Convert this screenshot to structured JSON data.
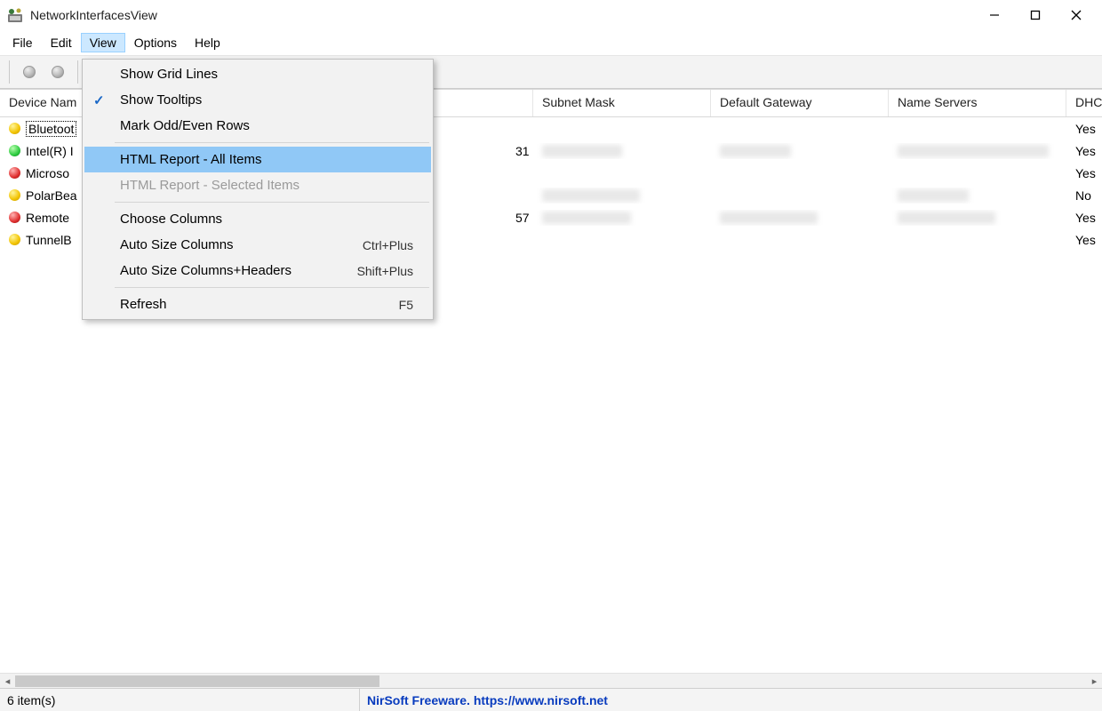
{
  "titlebar": {
    "title": "NetworkInterfacesView"
  },
  "menubar": {
    "items": [
      "File",
      "Edit",
      "View",
      "Options",
      "Help"
    ],
    "open_index": 2
  },
  "view_menu": {
    "items": [
      {
        "label": "Show Grid Lines",
        "checked": false,
        "enabled": true
      },
      {
        "label": "Show Tooltips",
        "checked": true,
        "enabled": true
      },
      {
        "label": "Mark Odd/Even Rows",
        "checked": false,
        "enabled": true
      },
      {
        "type": "sep"
      },
      {
        "label": "HTML Report - All Items",
        "enabled": true,
        "highlight": true
      },
      {
        "label": "HTML Report - Selected Items",
        "enabled": false
      },
      {
        "type": "sep"
      },
      {
        "label": "Choose Columns",
        "enabled": true
      },
      {
        "label": "Auto Size Columns",
        "enabled": true,
        "shortcut": "Ctrl+Plus"
      },
      {
        "label": "Auto Size Columns+Headers",
        "enabled": true,
        "shortcut": "Shift+Plus"
      },
      {
        "type": "sep"
      },
      {
        "label": "Refresh",
        "enabled": true,
        "shortcut": "F5"
      }
    ]
  },
  "columns": {
    "name": "Device Nam",
    "ip_hidden_header": "",
    "subnet": "Subnet Mask",
    "gateway": "Default Gateway",
    "nameservers": "Name Servers",
    "dhcp": "DHCP"
  },
  "rows": [
    {
      "status_color": "yellow",
      "name": "Bluetoot",
      "ip_tail": "",
      "subnet_blur_w": 0,
      "gw_blur_w": 0,
      "ns_blur_w": 0,
      "dhcp": "Yes",
      "focused": true
    },
    {
      "status_color": "green",
      "name": "Intel(R) I",
      "ip_tail": "31",
      "subnet_blur_w": 90,
      "gw_blur_w": 80,
      "ns_blur_w": 170,
      "dhcp": "Yes"
    },
    {
      "status_color": "red",
      "name": "Microso",
      "ip_tail": "",
      "subnet_blur_w": 0,
      "gw_blur_w": 0,
      "ns_blur_w": 0,
      "dhcp": "Yes"
    },
    {
      "status_color": "yellow",
      "name": "PolarBea",
      "ip_tail": "",
      "subnet_blur_w": 110,
      "gw_blur_w": 0,
      "ns_blur_w": 80,
      "dhcp": "No"
    },
    {
      "status_color": "red",
      "name": "Remote",
      "ip_tail": "57",
      "subnet_blur_w": 100,
      "gw_blur_w": 110,
      "ns_blur_w": 110,
      "dhcp": "Yes"
    },
    {
      "status_color": "yellow",
      "name": "TunnelB",
      "ip_tail": "",
      "subnet_blur_w": 0,
      "gw_blur_w": 0,
      "ns_blur_w": 0,
      "dhcp": "Yes"
    }
  ],
  "statusbar": {
    "count_text": "6 item(s)",
    "credit": "NirSoft Freeware. https://www.nirsoft.net"
  }
}
